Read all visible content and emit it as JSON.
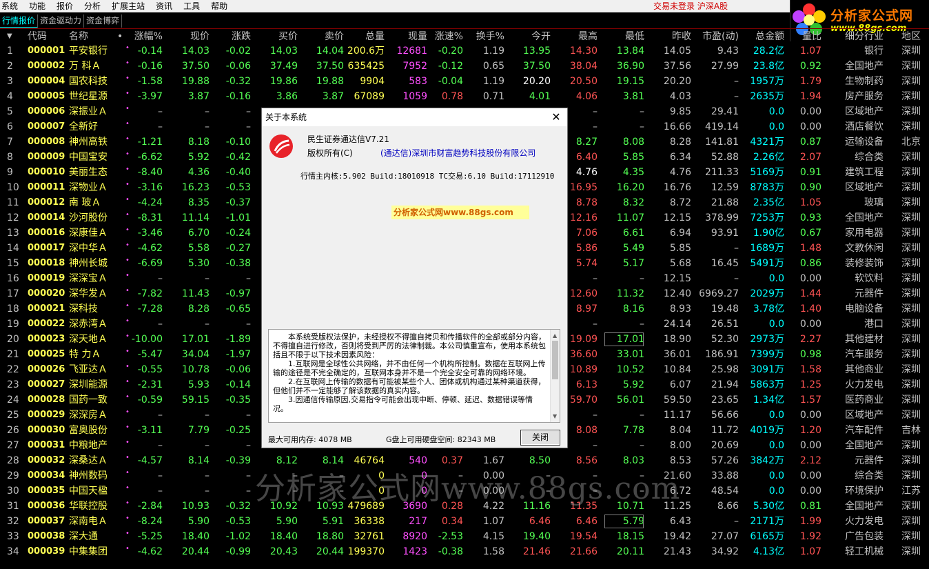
{
  "menu": {
    "items": [
      "系统",
      "功能",
      "报价",
      "分析",
      "扩展主站",
      "资讯",
      "工具",
      "帮助"
    ],
    "status": "交易未登录  沪深A股"
  },
  "logo": {
    "title": "分析家公式网",
    "url": "www.88gs.com"
  },
  "tabs": [
    "行情报价",
    "资金驱动力",
    "资金博弈"
  ],
  "columns": [
    "代码",
    "名称",
    "•",
    "涨幅%",
    "现价",
    "涨跌",
    "买价",
    "卖价",
    "总量",
    "现量",
    "涨速%",
    "换手%",
    "今开",
    "最高",
    "最低",
    "昨收",
    "市盈(动)",
    "总金额",
    "量比",
    "细分行业",
    "地区"
  ],
  "rows": [
    {
      "i": "1",
      "code": "000001",
      "name": "平安银行",
      "pct": "-0.14",
      "price": "14.03",
      "chg": "-0.02",
      "buy": "14.03",
      "sell": "14.04",
      "vol": "200.6万",
      "cur": "12681",
      "spd": "-0.20",
      "turn": "1.19",
      "open": "13.95",
      "high": "14.30",
      "low": "13.84",
      "prev": "14.05",
      "pe": "9.43",
      "amt": "28.2亿",
      "vr": "1.07",
      "ind": "银行",
      "reg": "深圳"
    },
    {
      "i": "2",
      "code": "000002",
      "name": "万 科Ａ",
      "pct": "-0.16",
      "price": "37.50",
      "chg": "-0.06",
      "buy": "37.49",
      "sell": "37.50",
      "vol": "635425",
      "cur": "7952",
      "spd": "-0.12",
      "turn": "0.65",
      "open": "37.50",
      "high": "38.04",
      "low": "36.90",
      "prev": "37.56",
      "pe": "27.99",
      "amt": "23.8亿",
      "vr": "0.92",
      "ind": "全国地产",
      "reg": "深圳"
    },
    {
      "i": "3",
      "code": "000004",
      "name": "国农科技",
      "pct": "-1.58",
      "price": "19.88",
      "chg": "-0.32",
      "buy": "19.86",
      "sell": "19.88",
      "vol": "9904",
      "cur": "583",
      "spd": "-0.04",
      "turn": "1.19",
      "open": "20.20",
      "high": "20.50",
      "low": "19.15",
      "prev": "20.20",
      "pe": "–",
      "amt": "1957万",
      "vr": "1.79",
      "ind": "生物制药",
      "reg": "深圳"
    },
    {
      "i": "4",
      "code": "000005",
      "name": "世纪星源",
      "pct": "-3.97",
      "price": "3.87",
      "chg": "-0.16",
      "buy": "3.86",
      "sell": "3.87",
      "vol": "67089",
      "cur": "1059",
      "spd": "0.78",
      "turn": "0.71",
      "open": "4.01",
      "high": "4.06",
      "low": "3.81",
      "prev": "4.03",
      "pe": "–",
      "amt": "2635万",
      "vr": "1.94",
      "ind": "房产服务",
      "reg": "深圳"
    },
    {
      "i": "5",
      "code": "000006",
      "name": "深振业Ａ",
      "pct": "–",
      "price": "–",
      "chg": "–",
      "buy": "",
      "sell": "",
      "vol": "",
      "cur": "",
      "spd": "",
      "turn": "",
      "open": "",
      "high": "–",
      "low": "–",
      "prev": "9.85",
      "pe": "29.41",
      "amt": "0.0",
      "vr": "0.00",
      "ind": "区域地产",
      "reg": "深圳"
    },
    {
      "i": "6",
      "code": "000007",
      "name": "全新好",
      "pct": "–",
      "price": "–",
      "chg": "–",
      "buy": "",
      "sell": "",
      "vol": "",
      "cur": "",
      "spd": "",
      "turn": "",
      "open": "",
      "high": "–",
      "low": "–",
      "prev": "16.66",
      "pe": "419.14",
      "amt": "0.0",
      "vr": "0.00",
      "ind": "酒店餐饮",
      "reg": "深圳"
    },
    {
      "i": "7",
      "code": "000008",
      "name": "神州高铁",
      "pct": "-1.21",
      "price": "8.18",
      "chg": "-0.10",
      "buy": "",
      "sell": "",
      "vol": "",
      "cur": "",
      "spd": "",
      "turn": "",
      "open": "",
      "high": "8.27",
      "low": "8.08",
      "prev": "8.28",
      "pe": "141.81",
      "amt": "4321万",
      "vr": "0.87",
      "ind": "运输设备",
      "reg": "北京"
    },
    {
      "i": "8",
      "code": "000009",
      "name": "中国宝安",
      "pct": "-6.62",
      "price": "5.92",
      "chg": "-0.42",
      "buy": "",
      "sell": "",
      "vol": "",
      "cur": "",
      "spd": "",
      "turn": "",
      "open": "",
      "high": "6.40",
      "low": "5.85",
      "prev": "6.34",
      "pe": "52.88",
      "amt": "2.26亿",
      "vr": "2.07",
      "ind": "综合类",
      "reg": "深圳"
    },
    {
      "i": "9",
      "code": "000010",
      "name": "美丽生态",
      "pct": "-8.40",
      "price": "4.36",
      "chg": "-0.40",
      "buy": "",
      "sell": "",
      "vol": "",
      "cur": "",
      "spd": "",
      "turn": "",
      "open": "",
      "high": "4.76",
      "low": "4.35",
      "prev": "4.76",
      "pe": "211.33",
      "amt": "5169万",
      "vr": "0.91",
      "ind": "建筑工程",
      "reg": "深圳"
    },
    {
      "i": "10",
      "code": "000011",
      "name": "深物业Ａ",
      "pct": "-3.16",
      "price": "16.23",
      "chg": "-0.53",
      "buy": "",
      "sell": "",
      "vol": "",
      "cur": "",
      "spd": "",
      "turn": "",
      "open": "",
      "high": "16.95",
      "low": "16.20",
      "prev": "16.76",
      "pe": "12.59",
      "amt": "8783万",
      "vr": "0.90",
      "ind": "区域地产",
      "reg": "深圳"
    },
    {
      "i": "11",
      "code": "000012",
      "name": "南 玻Ａ",
      "pct": "-4.24",
      "price": "8.35",
      "chg": "-0.37",
      "buy": "",
      "sell": "",
      "vol": "",
      "cur": "",
      "spd": "",
      "turn": "",
      "open": "",
      "high": "8.78",
      "low": "8.32",
      "prev": "8.72",
      "pe": "21.88",
      "amt": "2.35亿",
      "vr": "1.05",
      "ind": "玻璃",
      "reg": "深圳"
    },
    {
      "i": "12",
      "code": "000014",
      "name": "沙河股份",
      "pct": "-8.31",
      "price": "11.14",
      "chg": "-1.01",
      "buy": "",
      "sell": "",
      "vol": "",
      "cur": "",
      "spd": "",
      "turn": "",
      "open": "",
      "high": "12.16",
      "low": "11.07",
      "prev": "12.15",
      "pe": "378.99",
      "amt": "7253万",
      "vr": "0.93",
      "ind": "全国地产",
      "reg": "深圳"
    },
    {
      "i": "13",
      "code": "000016",
      "name": "深康佳Ａ",
      "pct": "-3.46",
      "price": "6.70",
      "chg": "-0.24",
      "buy": "",
      "sell": "",
      "vol": "",
      "cur": "",
      "spd": "",
      "turn": "",
      "open": "",
      "high": "7.06",
      "low": "6.61",
      "prev": "6.94",
      "pe": "93.91",
      "amt": "1.90亿",
      "vr": "0.67",
      "ind": "家用电器",
      "reg": "深圳"
    },
    {
      "i": "14",
      "code": "000017",
      "name": "深中华Ａ",
      "pct": "-4.62",
      "price": "5.58",
      "chg": "-0.27",
      "buy": "",
      "sell": "",
      "vol": "",
      "cur": "",
      "spd": "",
      "turn": "",
      "open": "",
      "high": "5.86",
      "low": "5.49",
      "prev": "5.85",
      "pe": "–",
      "amt": "1689万",
      "vr": "1.48",
      "ind": "文教休闲",
      "reg": "深圳"
    },
    {
      "i": "15",
      "code": "000018",
      "name": "神州长城",
      "pct": "-6.69",
      "price": "5.30",
      "chg": "-0.38",
      "buy": "",
      "sell": "",
      "vol": "",
      "cur": "",
      "spd": "",
      "turn": "",
      "open": "",
      "high": "5.74",
      "low": "5.17",
      "prev": "5.68",
      "pe": "16.45",
      "amt": "5491万",
      "vr": "0.86",
      "ind": "装修装饰",
      "reg": "深圳"
    },
    {
      "i": "16",
      "code": "000019",
      "name": "深深宝Ａ",
      "pct": "–",
      "price": "–",
      "chg": "–",
      "buy": "",
      "sell": "",
      "vol": "",
      "cur": "",
      "spd": "",
      "turn": "",
      "open": "",
      "high": "–",
      "low": "–",
      "prev": "12.15",
      "pe": "–",
      "amt": "0.0",
      "vr": "0.00",
      "ind": "软饮料",
      "reg": "深圳"
    },
    {
      "i": "17",
      "code": "000020",
      "name": "深华发Ａ",
      "pct": "-7.82",
      "price": "11.43",
      "chg": "-0.97",
      "buy": "",
      "sell": "",
      "vol": "",
      "cur": "",
      "spd": "",
      "turn": "",
      "open": "",
      "high": "12.60",
      "low": "11.32",
      "prev": "12.40",
      "pe": "6969.27",
      "amt": "2029万",
      "vr": "1.44",
      "ind": "元器件",
      "reg": "深圳"
    },
    {
      "i": "18",
      "code": "000021",
      "name": "深科技",
      "pct": "-7.28",
      "price": "8.28",
      "chg": "-0.65",
      "buy": "",
      "sell": "",
      "vol": "",
      "cur": "",
      "spd": "",
      "turn": "",
      "open": "",
      "high": "8.97",
      "low": "8.16",
      "prev": "8.93",
      "pe": "19.48",
      "amt": "3.78亿",
      "vr": "1.40",
      "ind": "电脑设备",
      "reg": "深圳"
    },
    {
      "i": "19",
      "code": "000022",
      "name": "深赤湾Ａ",
      "pct": "–",
      "price": "–",
      "chg": "–",
      "buy": "",
      "sell": "",
      "vol": "",
      "cur": "",
      "spd": "",
      "turn": "",
      "open": "",
      "high": "–",
      "low": "–",
      "prev": "24.14",
      "pe": "26.51",
      "amt": "0.0",
      "vr": "0.00",
      "ind": "港口",
      "reg": "深圳"
    },
    {
      "i": "20",
      "code": "000023",
      "name": "深天地Ａ",
      "pct": "-10.00",
      "price": "17.01",
      "chg": "-1.89",
      "buy": "",
      "sell": "",
      "vol": "",
      "cur": "",
      "spd": "",
      "turn": "",
      "open": "",
      "high": "19.09",
      "low": "17.01",
      "prev": "18.90",
      "pe": "52.30",
      "amt": "2973万",
      "vr": "2.27",
      "ind": "其他建材",
      "reg": "深圳"
    },
    {
      "i": "21",
      "code": "000025",
      "name": "特 力Ａ",
      "pct": "-5.47",
      "price": "34.04",
      "chg": "-1.97",
      "buy": "",
      "sell": "",
      "vol": "",
      "cur": "",
      "spd": "",
      "turn": "",
      "open": "",
      "high": "36.60",
      "low": "33.01",
      "prev": "36.01",
      "pe": "186.91",
      "amt": "7399万",
      "vr": "0.98",
      "ind": "汽车服务",
      "reg": "深圳"
    },
    {
      "i": "22",
      "code": "000026",
      "name": "飞亚达Ａ",
      "pct": "-0.55",
      "price": "10.78",
      "chg": "-0.06",
      "buy": "",
      "sell": "",
      "vol": "",
      "cur": "",
      "spd": "",
      "turn": "",
      "open": "",
      "high": "10.89",
      "low": "10.52",
      "prev": "10.84",
      "pe": "25.98",
      "amt": "3091万",
      "vr": "1.58",
      "ind": "其他商业",
      "reg": "深圳"
    },
    {
      "i": "23",
      "code": "000027",
      "name": "深圳能源",
      "pct": "-2.31",
      "price": "5.93",
      "chg": "-0.14",
      "buy": "",
      "sell": "",
      "vol": "",
      "cur": "",
      "spd": "",
      "turn": "",
      "open": "",
      "high": "6.13",
      "low": "5.92",
      "prev": "6.07",
      "pe": "21.94",
      "amt": "5863万",
      "vr": "1.25",
      "ind": "火力发电",
      "reg": "深圳"
    },
    {
      "i": "24",
      "code": "000028",
      "name": "国药一致",
      "pct": "-0.59",
      "price": "59.15",
      "chg": "-0.35",
      "buy": "",
      "sell": "",
      "vol": "",
      "cur": "",
      "spd": "",
      "turn": "",
      "open": "",
      "high": "59.70",
      "low": "56.01",
      "prev": "59.50",
      "pe": "23.65",
      "amt": "1.34亿",
      "vr": "1.57",
      "ind": "医药商业",
      "reg": "深圳"
    },
    {
      "i": "25",
      "code": "000029",
      "name": "深深房Ａ",
      "pct": "–",
      "price": "–",
      "chg": "–",
      "buy": "",
      "sell": "",
      "vol": "",
      "cur": "",
      "spd": "",
      "turn": "",
      "open": "",
      "high": "–",
      "low": "–",
      "prev": "11.17",
      "pe": "56.66",
      "amt": "0.0",
      "vr": "0.00",
      "ind": "区域地产",
      "reg": "深圳"
    },
    {
      "i": "26",
      "code": "000030",
      "name": "富奥股份",
      "pct": "-3.11",
      "price": "7.79",
      "chg": "-0.25",
      "buy": "",
      "sell": "",
      "vol": "",
      "cur": "",
      "spd": "",
      "turn": "",
      "open": "",
      "high": "8.08",
      "low": "7.78",
      "prev": "8.04",
      "pe": "11.72",
      "amt": "4019万",
      "vr": "1.20",
      "ind": "汽车配件",
      "reg": "吉林"
    },
    {
      "i": "27",
      "code": "000031",
      "name": "中粮地产",
      "pct": "–",
      "price": "–",
      "chg": "–",
      "buy": "",
      "sell": "",
      "vol": "",
      "cur": "",
      "spd": "",
      "turn": "",
      "open": "",
      "high": "–",
      "low": "–",
      "prev": "8.00",
      "pe": "20.69",
      "amt": "0.0",
      "vr": "0.00",
      "ind": "全国地产",
      "reg": "深圳"
    },
    {
      "i": "28",
      "code": "000032",
      "name": "深桑达Ａ",
      "pct": "-4.57",
      "price": "8.14",
      "chg": "-0.39",
      "buy": "8.12",
      "sell": "8.14",
      "vol": "46764",
      "cur": "540",
      "spd": "0.37",
      "turn": "1.67",
      "open": "8.50",
      "high": "8.56",
      "low": "8.03",
      "prev": "8.53",
      "pe": "57.26",
      "amt": "3842万",
      "vr": "2.12",
      "ind": "元器件",
      "reg": "深圳"
    },
    {
      "i": "29",
      "code": "000034",
      "name": "神州数码",
      "pct": "–",
      "price": "–",
      "chg": "–",
      "buy": "–",
      "sell": "–",
      "vol": "0",
      "cur": "0",
      "spd": "–",
      "turn": "0.00",
      "open": "–",
      "high": "–",
      "low": "–",
      "prev": "21.60",
      "pe": "33.88",
      "amt": "0.0",
      "vr": "0.00",
      "ind": "综合类",
      "reg": "深圳"
    },
    {
      "i": "30",
      "code": "000035",
      "name": "中国天楹",
      "pct": "–",
      "price": "–",
      "chg": "–",
      "buy": "–",
      "sell": "–",
      "vol": "0",
      "cur": "0",
      "spd": "–",
      "turn": "0.00",
      "open": "–",
      "high": "–",
      "low": "–",
      "prev": "6.72",
      "pe": "48.54",
      "amt": "0.0",
      "vr": "0.00",
      "ind": "环境保护",
      "reg": "江苏"
    },
    {
      "i": "31",
      "code": "000036",
      "name": "华联控股",
      "pct": "-2.84",
      "price": "10.93",
      "chg": "-0.32",
      "buy": "10.92",
      "sell": "10.93",
      "vol": "479689",
      "cur": "3690",
      "spd": "0.28",
      "turn": "4.22",
      "open": "11.16",
      "high": "11.35",
      "low": "10.71",
      "prev": "11.25",
      "pe": "8.66",
      "amt": "5.30亿",
      "vr": "0.81",
      "ind": "全国地产",
      "reg": "深圳"
    },
    {
      "i": "32",
      "code": "000037",
      "name": "深南电Ａ",
      "pct": "-8.24",
      "price": "5.90",
      "chg": "-0.53",
      "buy": "5.90",
      "sell": "5.91",
      "vol": "36338",
      "cur": "217",
      "spd": "0.34",
      "turn": "1.07",
      "open": "6.46",
      "high": "6.46",
      "low": "5.79",
      "prev": "6.43",
      "pe": "–",
      "amt": "2171万",
      "vr": "1.99",
      "ind": "火力发电",
      "reg": "深圳"
    },
    {
      "i": "33",
      "code": "000038",
      "name": "深大通",
      "pct": "-5.25",
      "price": "18.40",
      "chg": "-1.02",
      "buy": "18.40",
      "sell": "18.80",
      "vol": "32761",
      "cur": "8920",
      "spd": "-2.53",
      "turn": "4.15",
      "open": "19.40",
      "high": "19.54",
      "low": "18.15",
      "prev": "19.42",
      "pe": "27.07",
      "amt": "6165万",
      "vr": "1.92",
      "ind": "广告包装",
      "reg": "深圳"
    },
    {
      "i": "34",
      "code": "000039",
      "name": "中集集团",
      "pct": "-4.62",
      "price": "20.44",
      "chg": "-0.99",
      "buy": "20.43",
      "sell": "20.44",
      "vol": "199370",
      "cur": "1423",
      "spd": "-0.38",
      "turn": "1.58",
      "open": "21.46",
      "high": "21.66",
      "low": "20.11",
      "prev": "21.43",
      "pe": "34.92",
      "amt": "4.13亿",
      "vr": "1.07",
      "ind": "轻工机械",
      "reg": "深圳"
    }
  ],
  "watermark": "分析家公式网www.88gs.com",
  "dialog": {
    "title": "关于本系统",
    "app_name": "民生证券通达信V7.21",
    "copyright_label": "版权所有(C)",
    "company": "(通达信)深圳市财富趋势科技股份有限公司",
    "build": "行情主内核:5.902 Build:18010918 TC交易:6.10 Build:17112910",
    "banner": "分析家公式网www.88gs.com",
    "text": [
      "本系统受版权法保护，未经授权不得擅自拷贝和传播软件的全部或部分内容，不得擅自进行修改，否则将受到严厉的法律制裁。本公司慎重宣布，使用本系统包括且不限于以下技术因素风险：",
      "1.互联网是全球性公共网络，并不由任何一个机构所控制。数据在互联网上传输的途径是不完全确定的，互联网本身并不是一个完全安全可靠的网络环境。",
      "2.在互联网上传输的数据有可能被某些个人、团体或机构通过某种渠道获得，但他们并不一定能够了解该数据的真实内容。",
      "3.因通信传输原因,交易指令可能会出现中断、停顿、延迟、数据错误等情况。"
    ],
    "memory": "最大可用内存: 4078 MB",
    "disk": "G盘上可用硬盘空间: 82343 MB",
    "close_label": "关闭"
  }
}
